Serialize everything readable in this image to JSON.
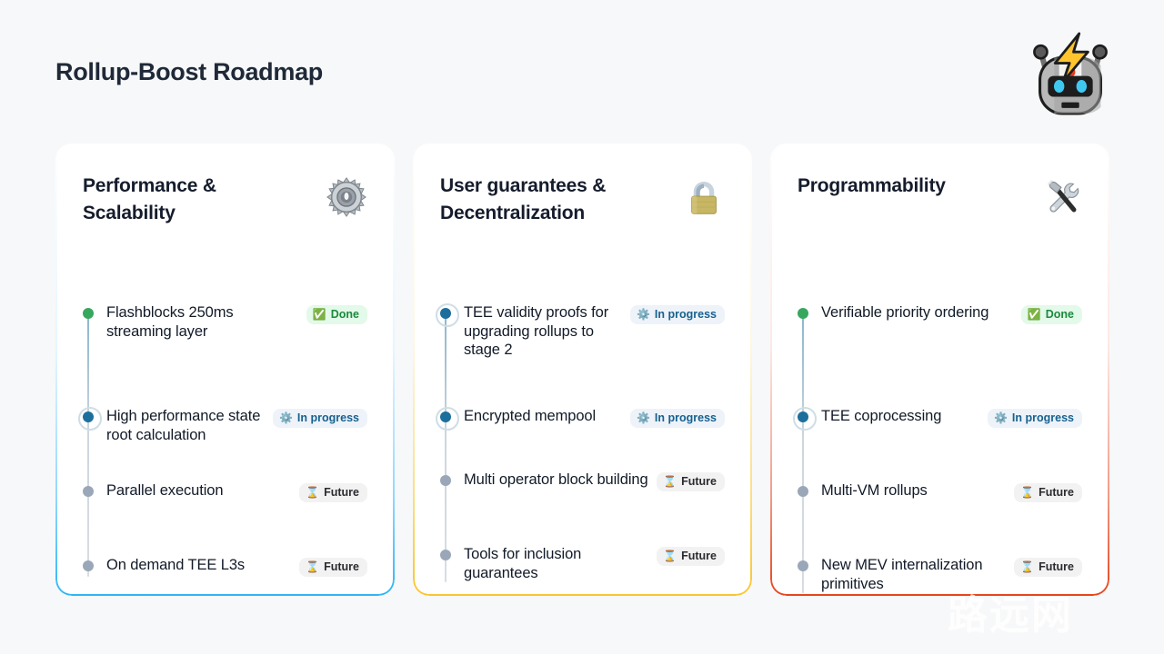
{
  "header": {
    "title": "Rollup-Boost Roadmap",
    "logo_icon": "robot-head-with-lightning-icon"
  },
  "watermark": {
    "text": "路远网"
  },
  "status_styles": {
    "done": {
      "label": "Done",
      "icon": "white-check-mark-icon",
      "glyph": "✅",
      "pill_bg": "#e3f9e9",
      "text_color": "#1b8a3e",
      "dot_color": "#37a75e"
    },
    "progress": {
      "label": "In progress",
      "icon": "gear-icon",
      "glyph": "⚙️",
      "pill_bg": "#eef3f9",
      "text_color": "#17618f",
      "dot_color": "#1c6f9c"
    },
    "future": {
      "label": "Future",
      "icon": "hourglass-icon",
      "glyph": "⌛",
      "pill_bg": "#f2f2f3",
      "text_color": "#2b2b2f",
      "dot_color": "#9aa7b8"
    }
  },
  "cards": [
    {
      "title": "Performance & Scalability",
      "icon": "gear-icon",
      "accent_color": "#2fb5f7",
      "items": [
        {
          "label": "Flashblocks 250ms streaming layer",
          "status": "done",
          "status_label": "Done"
        },
        {
          "label": "High performance state root calculation",
          "status": "progress",
          "status_label": "In progress"
        },
        {
          "label": "Parallel execution",
          "status": "future",
          "status_label": "Future"
        },
        {
          "label": "On demand TEE L3s",
          "status": "future",
          "status_label": "Future"
        }
      ]
    },
    {
      "title": "User guarantees & Decentralization",
      "icon": "padlock-icon",
      "accent_color": "#fac531",
      "items": [
        {
          "label": "TEE validity proofs for upgrading rollups to stage 2",
          "status": "progress",
          "status_label": "In progress"
        },
        {
          "label": "Encrypted mempool",
          "status": "progress",
          "status_label": "In progress"
        },
        {
          "label": "Multi operator block building",
          "status": "future",
          "status_label": "Future"
        },
        {
          "label": "Tools for inclusion guarantees",
          "status": "future",
          "status_label": "Future"
        }
      ]
    },
    {
      "title": "Programmability",
      "icon": "hammer-and-wrench-icon",
      "accent_color": "#e8441c",
      "items": [
        {
          "label": "Verifiable priority ordering",
          "status": "done",
          "status_label": "Done"
        },
        {
          "label": "TEE coprocessing",
          "status": "progress",
          "status_label": "In progress"
        },
        {
          "label": "Multi-VM rollups",
          "status": "future",
          "status_label": "Future"
        },
        {
          "label": "New MEV internalization primitives",
          "status": "future",
          "status_label": "Future"
        }
      ]
    }
  ]
}
